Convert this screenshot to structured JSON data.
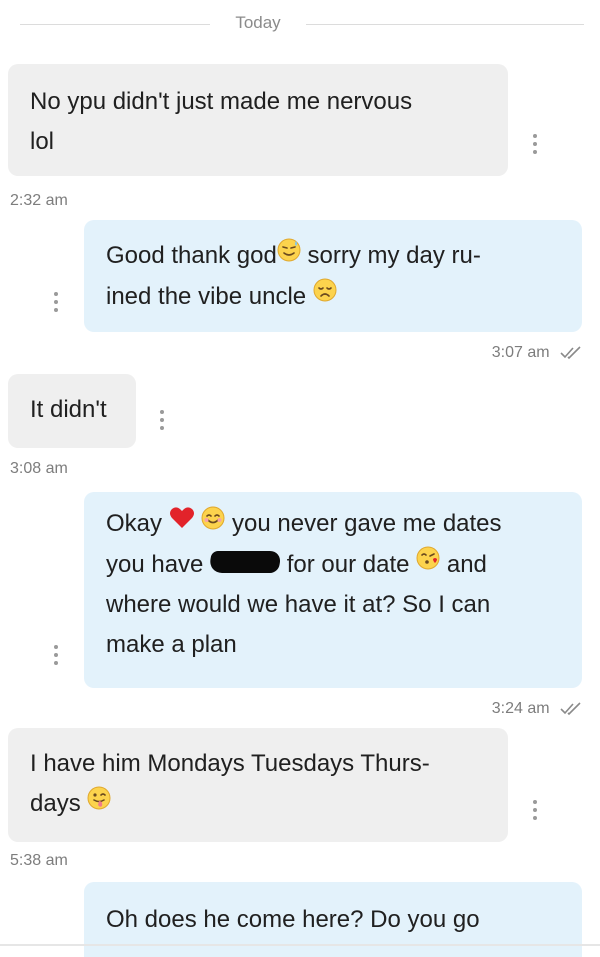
{
  "date_separator": "Today",
  "messages": [
    {
      "direction": "incoming",
      "line1": "No ypu didn't just made me nervous",
      "line2": "lol",
      "time": "2:32 am"
    },
    {
      "direction": "outgoing",
      "line1_a": "Good thank god",
      "line1_b": "sorry my day ru-",
      "line2_a": "ined the vibe uncle",
      "time": "3:07 am",
      "status": "read"
    },
    {
      "direction": "incoming",
      "line1": "It didn't",
      "time": "3:08 am"
    },
    {
      "direction": "outgoing",
      "line1_a": "Okay",
      "line1_b": "you never gave me dates",
      "line2_a": "you have",
      "line2_b": "for our date",
      "line2_c": "and",
      "line3": "where would we have it at? So I can",
      "line4": "make a plan",
      "time": "3:24 am",
      "status": "read"
    },
    {
      "direction": "incoming",
      "line1": "I have him Mondays Tuesdays Thurs-",
      "line2": "days",
      "time": "5:38 am"
    },
    {
      "direction": "outgoing",
      "line1": "Oh does he come here? Do you go"
    }
  ],
  "colors": {
    "incoming_bubble": "#efefef",
    "outgoing_bubble": "#e3f2fb",
    "timestamp": "#7d7d7d"
  },
  "icons": [
    "more-vert-icon",
    "double-check-icon",
    "sweat-smile-emoji",
    "disappointed-emoji",
    "red-heart-emoji",
    "blush-emoji",
    "kissing-heart-emoji",
    "winking-tongue-emoji"
  ]
}
